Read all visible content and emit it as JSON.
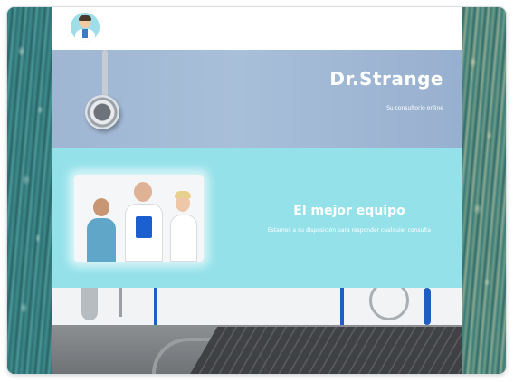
{
  "site": {
    "brand": "Dr.Strange",
    "tagline": "Su consultorio online"
  },
  "team_section": {
    "title": "El mejor equipo",
    "text": "Estamos a su disposición para responder cualquier consulta"
  },
  "icons": {
    "logo": "doctor-avatar-icon"
  },
  "colors": {
    "hero_bg": "#a8bfd9",
    "team_bg": "#94e1ea",
    "text_on_color": "#ffffff"
  }
}
